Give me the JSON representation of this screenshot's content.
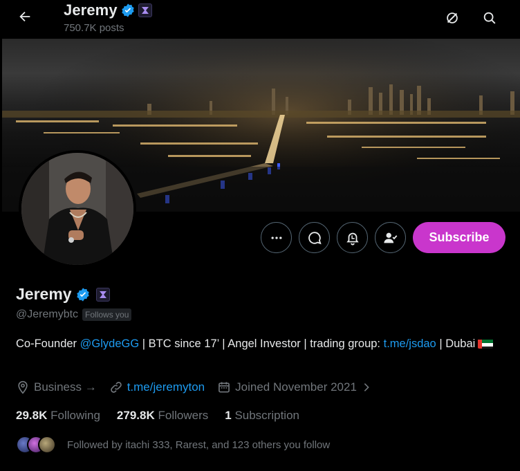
{
  "header": {
    "name": "Jeremy",
    "posts": "750.7K posts"
  },
  "actions": {
    "subscribe_label": "Subscribe"
  },
  "profile": {
    "name": "Jeremy",
    "handle": "@Jeremybtc",
    "follows_you": "Follows you",
    "bio": {
      "part1": "Co-Founder ",
      "mention": "@GlydeGG",
      "part2": " | BTC since 17’ | Angel Investor | trading group: ",
      "link": "t.me/jsdao",
      "part3": " | Dubai"
    },
    "category": "Business →",
    "website": "t.me/jeremyton",
    "joined": "Joined November 2021"
  },
  "stats": {
    "following_count": "29.8K",
    "following_label": "Following",
    "followers_count": "279.8K",
    "followers_label": "Followers",
    "subscription_count": "1",
    "subscription_label": "Subscription"
  },
  "followed_by": "Followed by itachi 333, Rarest, and 123 others you follow",
  "colors": {
    "accent": "#1d9bf0",
    "subscribe": "#c936cc",
    "muted": "#71767b"
  },
  "icons": [
    "back-arrow-icon",
    "verified-badge-icon",
    "affiliate-badge-icon",
    "grok-icon",
    "search-icon",
    "more-icon",
    "message-icon",
    "notification-bell-icon",
    "following-user-icon",
    "location-icon",
    "link-icon",
    "calendar-icon",
    "chevron-right-icon",
    "uae-flag-icon"
  ]
}
